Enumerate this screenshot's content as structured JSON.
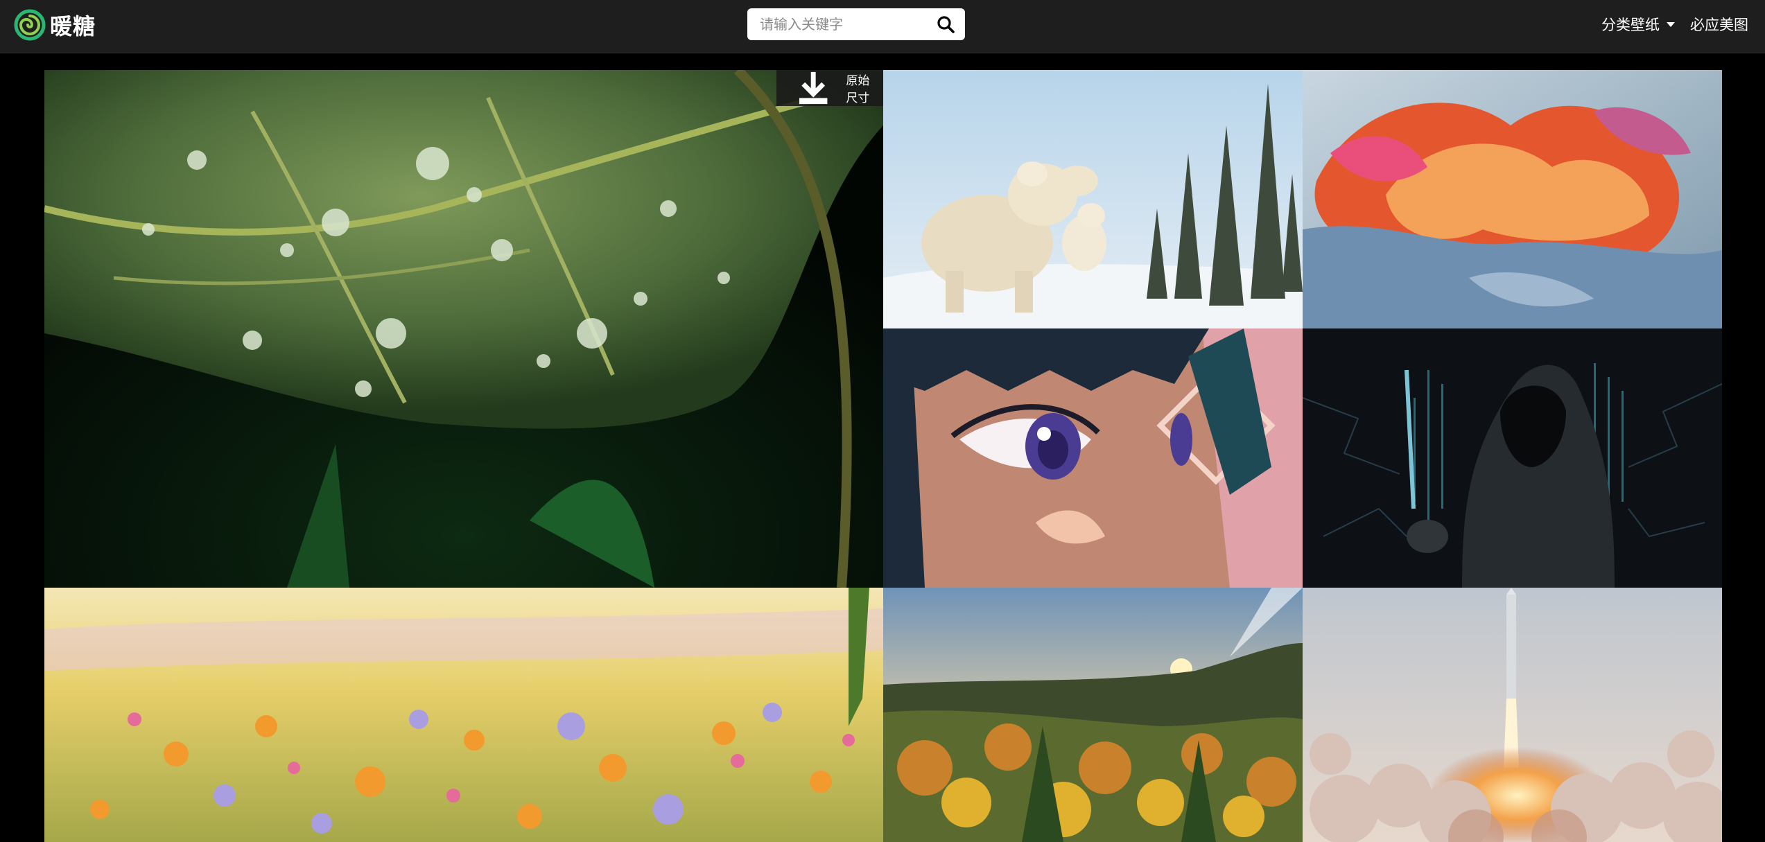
{
  "header": {
    "logo_text": "暖糖",
    "search": {
      "placeholder": "请输入关键字",
      "value": ""
    },
    "nav": {
      "category_label": "分类壁纸",
      "bing_label": "必应美图"
    }
  },
  "gallery": {
    "download_label": "原始尺寸",
    "tiles": [
      {
        "subject": "dew-drops-on-leaf"
      },
      {
        "subject": "polar-bears-in-snow"
      },
      {
        "subject": "abstract-colorful-waves"
      },
      {
        "subject": "anime-girl-eye"
      },
      {
        "subject": "hooded-hacker"
      },
      {
        "subject": "wildflower-meadow"
      },
      {
        "subject": "autumn-forest-sunset"
      },
      {
        "subject": "rocket-launch"
      }
    ]
  },
  "colors": {
    "header_bg": "#1e1e1e",
    "page_bg": "#000000",
    "logo_accent": "#2bb673"
  }
}
